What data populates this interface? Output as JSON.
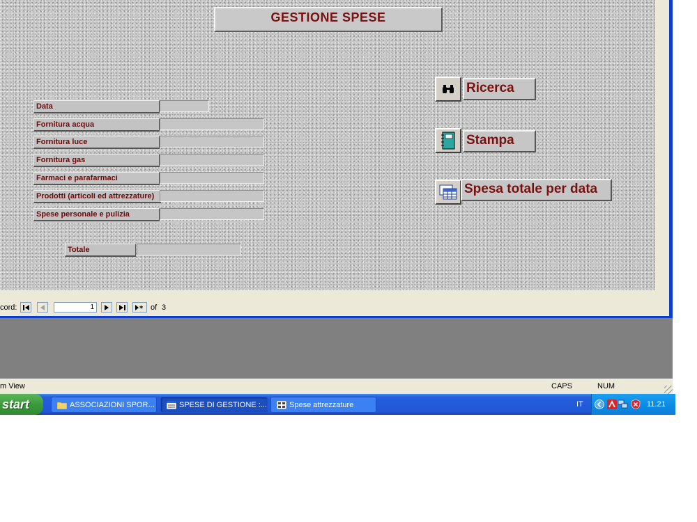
{
  "form": {
    "title": "GESTIONE SPESE",
    "fields": [
      {
        "label": "Data"
      },
      {
        "label": "Fornitura acqua"
      },
      {
        "label": "Fornitura luce"
      },
      {
        "label": "Fornitura gas"
      },
      {
        "label": "Farmaci e parafarmaci"
      },
      {
        "label": "Prodotti (articoli ed attrezzature)"
      },
      {
        "label": "Spese personale e pulizia"
      }
    ],
    "total_label": "Totale",
    "buttons": {
      "ricerca": "Ricerca",
      "stampa": "Stampa",
      "spesa_totale": "Spesa totale per data"
    },
    "icons": {
      "ricerca": "binoculars-icon",
      "stampa": "notebook-icon",
      "spesa_totale": "spreadsheet-icon"
    }
  },
  "navigation": {
    "label": "cord:",
    "current": "1",
    "of": "of",
    "total": "3"
  },
  "statusbar": {
    "view": "m View",
    "caps": "CAPS",
    "num": "NUM"
  },
  "taskbar": {
    "start": "start",
    "tasks": [
      {
        "label": "ASSOCIAZIONI SPOR..."
      },
      {
        "label": "SPESE DI GESTIONE :..."
      },
      {
        "label": "Spese attrezzature"
      }
    ],
    "language": "IT",
    "clock": "11.21"
  },
  "colors": {
    "label_text": "#7a1010",
    "taskbar_blue": "#245edb",
    "start_green": "#3c9a3c"
  }
}
